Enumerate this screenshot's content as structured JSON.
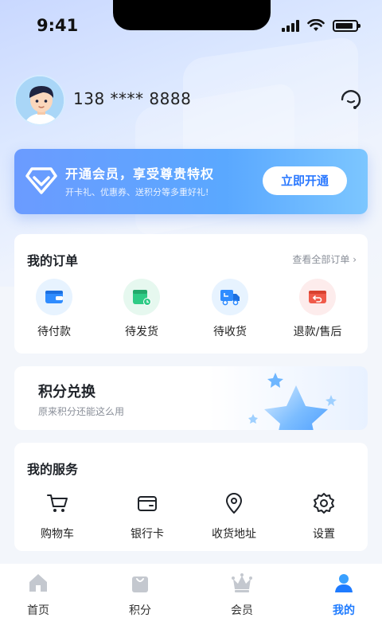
{
  "status_bar": {
    "time": "9:41"
  },
  "profile": {
    "phone": "138 **** 8888"
  },
  "vip": {
    "title": "开通会员，享受尊贵特权",
    "subtitle": "开卡礼、优惠券、送积分等多重好礼!",
    "button": "立即开通"
  },
  "orders": {
    "title": "我的订单",
    "see_all": "查看全部订单",
    "items": [
      {
        "label": "待付款",
        "icon": "wallet-icon",
        "color": "#2f8cff"
      },
      {
        "label": "待发货",
        "icon": "package-icon",
        "color": "#2ecb85"
      },
      {
        "label": "待收货",
        "icon": "truck-icon",
        "color": "#2f8cff"
      },
      {
        "label": "退款/售后",
        "icon": "refund-icon",
        "color": "#f05a4a"
      }
    ]
  },
  "points": {
    "title": "积分兑换",
    "subtitle": "原来积分还能这么用"
  },
  "services": {
    "title": "我的服务",
    "items": [
      {
        "label": "购物车",
        "icon": "cart-icon"
      },
      {
        "label": "银行卡",
        "icon": "card-icon"
      },
      {
        "label": "收货地址",
        "icon": "location-icon"
      },
      {
        "label": "设置",
        "icon": "gear-icon"
      }
    ]
  },
  "tabbar": {
    "items": [
      {
        "label": "首页",
        "icon": "home-icon"
      },
      {
        "label": "积分",
        "icon": "bag-icon"
      },
      {
        "label": "会员",
        "icon": "crown-icon"
      },
      {
        "label": "我的",
        "icon": "user-icon",
        "active": true
      }
    ]
  },
  "colors": {
    "accent": "#1e7bff",
    "vip_start": "#6b9bff",
    "vip_end": "#7cc6ff"
  }
}
